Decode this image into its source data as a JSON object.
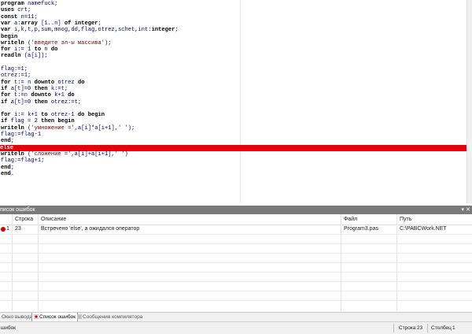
{
  "editor": {
    "lines": [
      {
        "text": "program namefuck;"
      },
      {
        "text": "uses crt;"
      },
      {
        "text": "const n=11;"
      },
      {
        "text": "var a:array [1..n] of integer;"
      },
      {
        "text": "var i,k,t,p,sum,mnog,dd,flag,otrez,schet,int:integer;"
      },
      {
        "text": "begin"
      },
      {
        "text": "writeln ('введите эл-ы массива');"
      },
      {
        "text": "for i:= 1 to n do"
      },
      {
        "text": "readln (a[i]);"
      },
      {
        "text": ""
      },
      {
        "text": "flag:=1;"
      },
      {
        "text": "otrez:=1;"
      },
      {
        "text": "for t:= n downto otrez do"
      },
      {
        "text": "if a[t]=0 then k:=t;"
      },
      {
        "text": "for t:=n downto k+1 do"
      },
      {
        "text": "if a[t]=0 then otrez:=t;"
      },
      {
        "text": ""
      },
      {
        "text": "for i:= k+1 to otrez-1 do begin"
      },
      {
        "text": "if flag = 2 then begin"
      },
      {
        "text": "writeln ('умножение =',a[i]*a[i+1],' ');"
      },
      {
        "text": "flag:=flag-1"
      },
      {
        "text": "end;"
      },
      {
        "text": "else",
        "highlight": true
      },
      {
        "text": "writeln ('сложение =',a[i]+a[i+1],' ')"
      },
      {
        "text": "flag:=flag+1;"
      },
      {
        "text": "end;"
      },
      {
        "text": "end."
      }
    ],
    "highlight_color": "#e8000a"
  },
  "error_panel": {
    "title": "писок ошибок",
    "pin_icon": "pin-icon",
    "close_icon": "close-icon",
    "columns": {
      "num": "",
      "line": "Строка",
      "description": "Описание",
      "file": "Файл",
      "path": "Путь"
    },
    "rows": [
      {
        "num": "1",
        "line": "23",
        "description": "Встречено 'else', а ожидался оператор",
        "file": "Program3.pas",
        "path": "C:\\PABCWork.NET"
      }
    ]
  },
  "tabs": [
    {
      "label": "Окно вывода",
      "active": false
    },
    {
      "label": "Список ошибок",
      "active": true
    },
    {
      "label": "Сообщения компилятора",
      "active": false
    }
  ],
  "statusbar": {
    "left": "шибок",
    "line_label": "Строка",
    "line_value": "23",
    "col_label": "Столбец",
    "col_value": "1"
  }
}
